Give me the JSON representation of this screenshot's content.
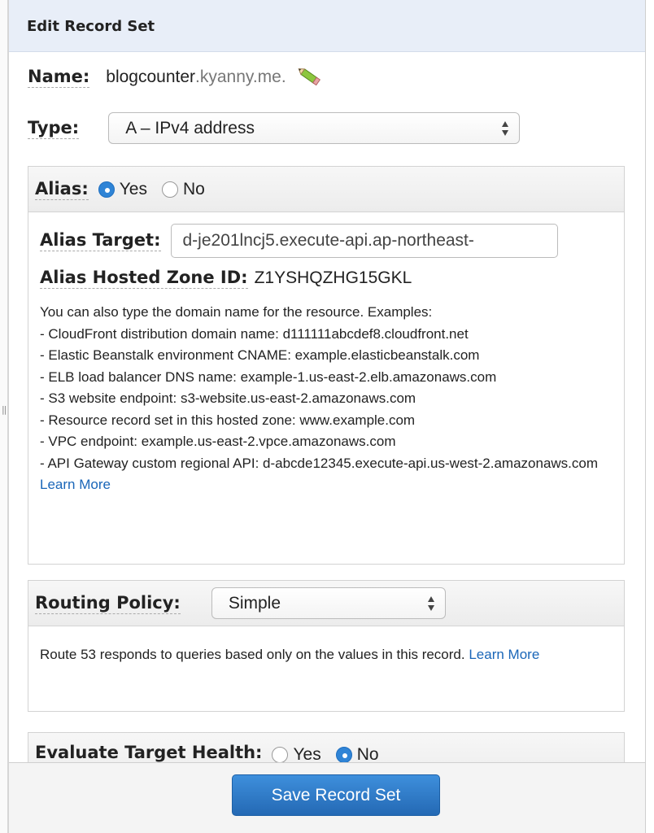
{
  "header": {
    "title": "Edit Record Set"
  },
  "name": {
    "label": "Name:",
    "value": "blogcounter",
    "suffix": ".kyanny.me.",
    "edit_icon": "pencil-icon"
  },
  "type": {
    "label": "Type:",
    "selected": "A – IPv4 address"
  },
  "alias": {
    "label": "Alias:",
    "yes_label": "Yes",
    "no_label": "No",
    "selected": "Yes",
    "target_label": "Alias Target:",
    "target_value": "d-je201lncj5.execute-api.ap-northeast-",
    "zone_label": "Alias Hosted Zone ID:",
    "zone_value": "Z1YSHQZHG15GKL",
    "help_intro": "You can also type the domain name for the resource. Examples:",
    "examples": [
      "- CloudFront distribution domain name: d111111abcdef8.cloudfront.net",
      "- Elastic Beanstalk environment CNAME: example.elasticbeanstalk.com",
      "- ELB load balancer DNS name: example-1.us-east-2.elb.amazonaws.com",
      "- S3 website endpoint: s3-website.us-east-2.amazonaws.com",
      "- Resource record set in this hosted zone: www.example.com",
      "- VPC endpoint: example.us-east-2.vpce.amazonaws.com",
      "- API Gateway custom regional API: d-abcde12345.execute-api.us-west-2.amazonaws.com"
    ],
    "learn_more": "Learn More"
  },
  "routing": {
    "label": "Routing Policy:",
    "selected": "Simple",
    "description": "Route 53 responds to queries based only on the values in this record.",
    "learn_more": "Learn More"
  },
  "evaluate": {
    "label": "Evaluate Target Health:",
    "yes_label": "Yes",
    "no_label": "No",
    "selected": "No"
  },
  "footer": {
    "save_label": "Save Record Set"
  },
  "colors": {
    "accent": "#2f84d6",
    "link": "#1a66b8",
    "header_bg": "#e8eef8"
  }
}
